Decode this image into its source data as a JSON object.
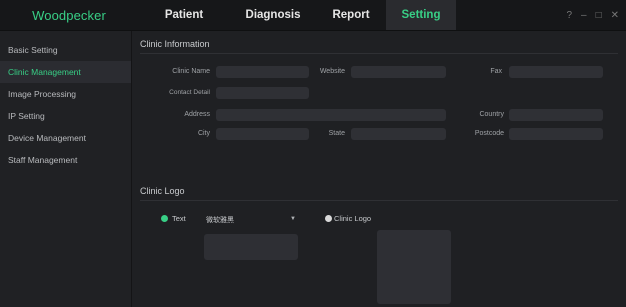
{
  "app": {
    "logo": "Woodpecker",
    "tabs": [
      "Patient",
      "Diagnosis",
      "Report",
      "Setting"
    ],
    "active_tab": "Setting",
    "controls": {
      "help": "?",
      "minimize": "–",
      "maximize": "□",
      "close": "✕"
    }
  },
  "sidebar": {
    "items": [
      {
        "label": "Basic Setting"
      },
      {
        "label": "Clinic Management"
      },
      {
        "label": "Image Processing"
      },
      {
        "label": "IP Setting"
      },
      {
        "label": "Device Management"
      },
      {
        "label": "Staff Management"
      }
    ],
    "active_index": 1
  },
  "clinic_info": {
    "title": "Clinic Information",
    "labels": {
      "clinic_name": "Clinic Name",
      "website": "Website",
      "fax": "Fax",
      "contact_detail": "Contact Detail",
      "address": "Address",
      "country": "Country",
      "city": "City",
      "state": "State",
      "postcode": "Postcode"
    },
    "values": {
      "clinic_name": "",
      "website": "",
      "fax": "",
      "contact_detail": "",
      "address": "",
      "country": "",
      "city": "",
      "state": "",
      "postcode": ""
    }
  },
  "clinic_logo": {
    "title": "Clinic Logo",
    "text_option": "Text",
    "logo_option": "Clinic Logo",
    "selected_option": "Text",
    "font_select_value": "微软雅黑"
  },
  "colors": {
    "accent": "#38cf86",
    "background": "#1f2023",
    "input": "#2f3035"
  }
}
